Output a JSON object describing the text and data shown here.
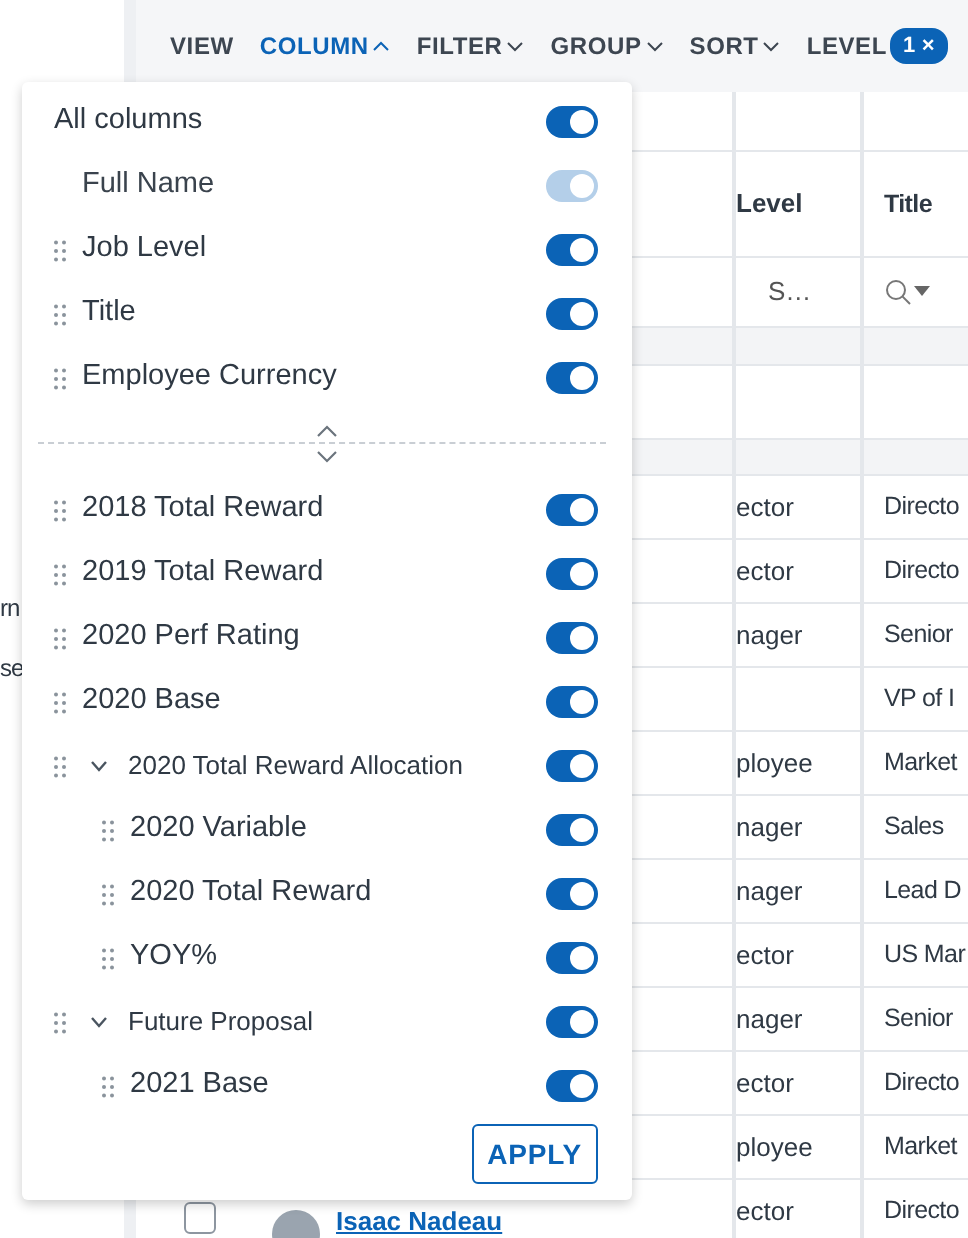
{
  "left_panel": {
    "texts": [
      "rn",
      "se"
    ]
  },
  "toolbar": {
    "menus": [
      {
        "label": "VIEW",
        "kind": "plain",
        "selected": false
      },
      {
        "label": "COLUMN",
        "kind": "dropdown",
        "selected": true,
        "expanded": true
      },
      {
        "label": "FILTER",
        "kind": "dropdown",
        "selected": false,
        "expanded": false
      },
      {
        "label": "GROUP",
        "kind": "dropdown",
        "selected": false,
        "expanded": false
      },
      {
        "label": "SORT",
        "kind": "dropdown",
        "selected": false,
        "expanded": false
      },
      {
        "label": "LEVEL",
        "kind": "badge",
        "selected": false,
        "badge": "1",
        "remove": "×"
      }
    ]
  },
  "table": {
    "columns": [
      "Level",
      "Title"
    ],
    "filters": [
      {
        "kind": "text",
        "text": "S…"
      },
      {
        "kind": "search"
      }
    ],
    "rows": [
      {
        "cells": [
          "ector",
          "Directo"
        ]
      },
      {
        "cells": [
          "ector",
          "Directo"
        ]
      },
      {
        "cells": [
          "nager",
          "Senior"
        ]
      },
      {
        "cells": [
          "",
          "VP of I"
        ]
      },
      {
        "cells": [
          "ployee",
          "Market"
        ]
      },
      {
        "cells": [
          "nager",
          "Sales"
        ]
      },
      {
        "cells": [
          "nager",
          "Lead D"
        ]
      },
      {
        "cells": [
          "ector",
          "US Mar"
        ]
      },
      {
        "cells": [
          "nager",
          "Senior"
        ]
      },
      {
        "cells": [
          "ector",
          "Directo"
        ]
      },
      {
        "cells": [
          "ployee",
          "Market"
        ]
      },
      {
        "cells": [
          "ector",
          "Directo"
        ],
        "name": "Isaac Nadeau",
        "checked": false
      }
    ]
  },
  "column_menu": {
    "all": {
      "label": "All columns",
      "on": true
    },
    "pinned": [
      {
        "label": "Full Name",
        "on": true,
        "disabled": true,
        "draggable": false
      },
      {
        "label": "Job Level",
        "on": true,
        "disabled": false,
        "draggable": true
      },
      {
        "label": "Title",
        "on": true,
        "disabled": false,
        "draggable": true
      },
      {
        "label": "Employee Currency",
        "on": true,
        "disabled": false,
        "draggable": true
      }
    ],
    "columns": [
      {
        "label": "2018 Total Reward",
        "on": true,
        "disabled": false,
        "draggable": true
      },
      {
        "label": "2019 Total Reward",
        "on": true,
        "disabled": false,
        "draggable": true
      },
      {
        "label": "2020 Perf Rating",
        "on": true,
        "disabled": false,
        "draggable": true
      },
      {
        "label": "2020 Base",
        "on": true,
        "disabled": false,
        "draggable": true
      },
      {
        "label": "2020 Total Reward Allocation",
        "on": true,
        "disabled": false,
        "draggable": true,
        "expanded": true,
        "children": [
          {
            "label": "2020 Variable",
            "on": true,
            "disabled": false,
            "draggable": true
          },
          {
            "label": "2020 Total Reward",
            "on": true,
            "disabled": false,
            "draggable": true
          },
          {
            "label": "YOY%",
            "on": true,
            "disabled": false,
            "draggable": true
          }
        ]
      },
      {
        "label": "Future Proposal",
        "on": true,
        "disabled": false,
        "draggable": true,
        "expanded": true,
        "children": [
          {
            "label": "2021 Base",
            "on": true,
            "disabled": false,
            "draggable": true
          }
        ]
      }
    ],
    "apply": "APPLY"
  }
}
